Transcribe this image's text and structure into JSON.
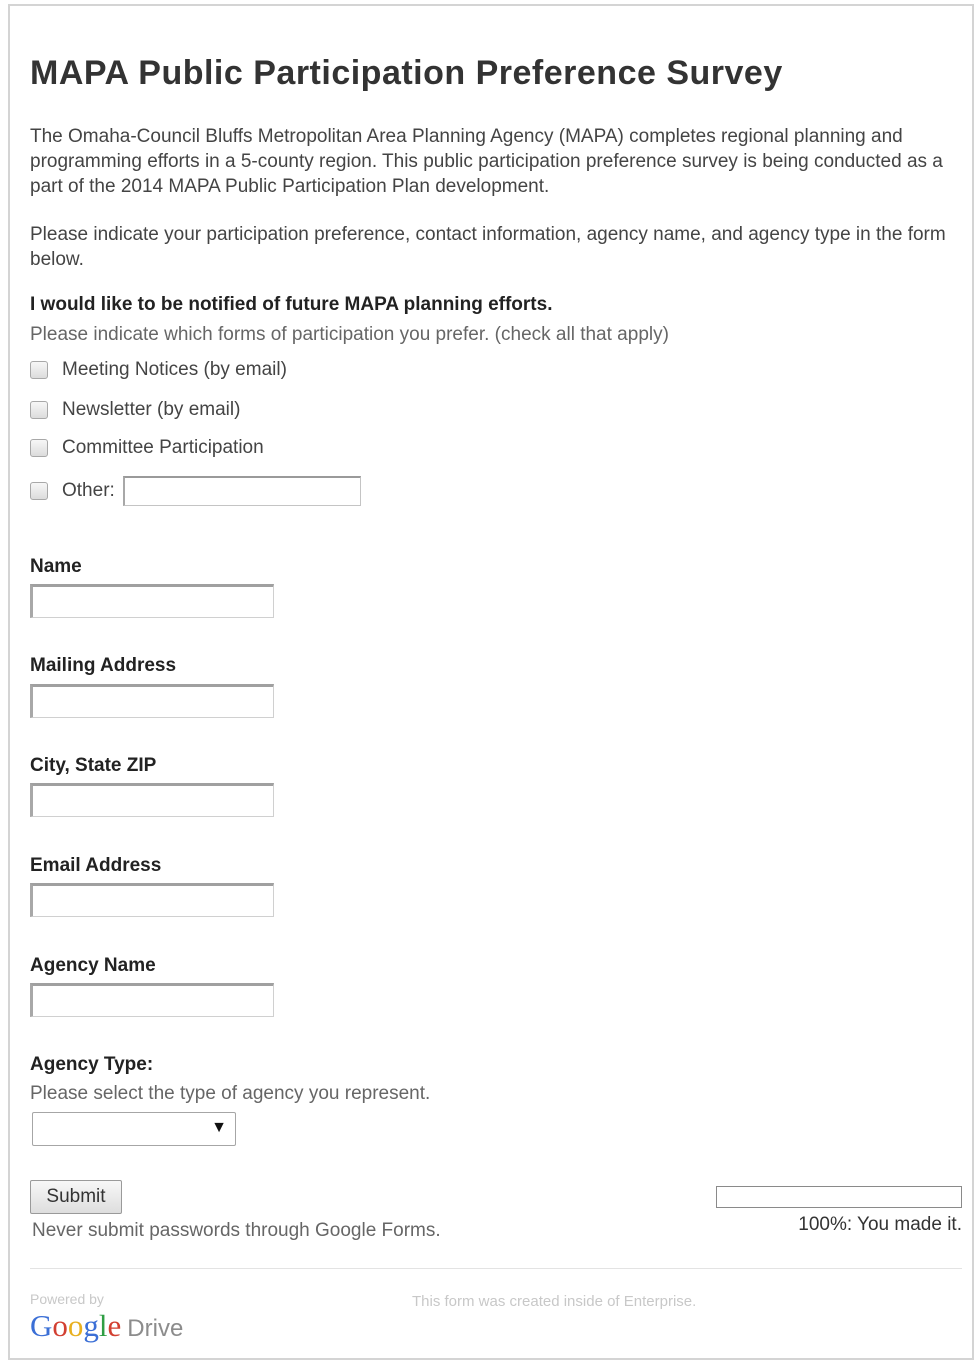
{
  "form": {
    "title": "MAPA Public Participation Preference Survey",
    "description_1": "The Omaha-Council Bluffs Metropolitan Area Planning Agency (MAPA) completes regional planning and programming efforts in a 5-county region.  This public participation preference survey is being conducted as a part of the 2014 MAPA Public Participation Plan development.",
    "description_2": "Please indicate your participation preference, contact information, agency name, and agency type in the form below."
  },
  "notify_question": {
    "label": "I would like to be notified of future MAPA planning efforts.",
    "help": "Please indicate which forms of participation you prefer. (check all that apply)",
    "options": [
      {
        "label": "Meeting Notices (by email)",
        "checked": false
      },
      {
        "label": "Newsletter (by email)",
        "checked": false
      },
      {
        "label": "Committee Participation",
        "checked": false
      },
      {
        "label": "Other:",
        "checked": false,
        "value": ""
      }
    ]
  },
  "fields": [
    {
      "label": "Name",
      "value": ""
    },
    {
      "label": "Mailing Address",
      "value": ""
    },
    {
      "label": "City, State ZIP",
      "value": ""
    },
    {
      "label": "Email Address",
      "value": ""
    },
    {
      "label": "Agency Name",
      "value": ""
    }
  ],
  "agency_type": {
    "label": "Agency Type:",
    "help": "Please select the type of agency you represent.",
    "selected": ""
  },
  "submit": {
    "label": "Submit",
    "warning": "Never submit passwords through Google Forms."
  },
  "progress": {
    "percent": 100,
    "text": "100%: You made it."
  },
  "footer": {
    "powered_by": "Powered by",
    "logo_letters": [
      "G",
      "o",
      "o",
      "g",
      "l",
      "e"
    ],
    "product": "Drive",
    "created_note": "This form was created inside of Enterprise."
  },
  "colors": {
    "google_blue": "#3b6fd6",
    "google_red": "#d23f31",
    "google_yellow": "#e8b020",
    "google_green": "#2f9e44"
  }
}
